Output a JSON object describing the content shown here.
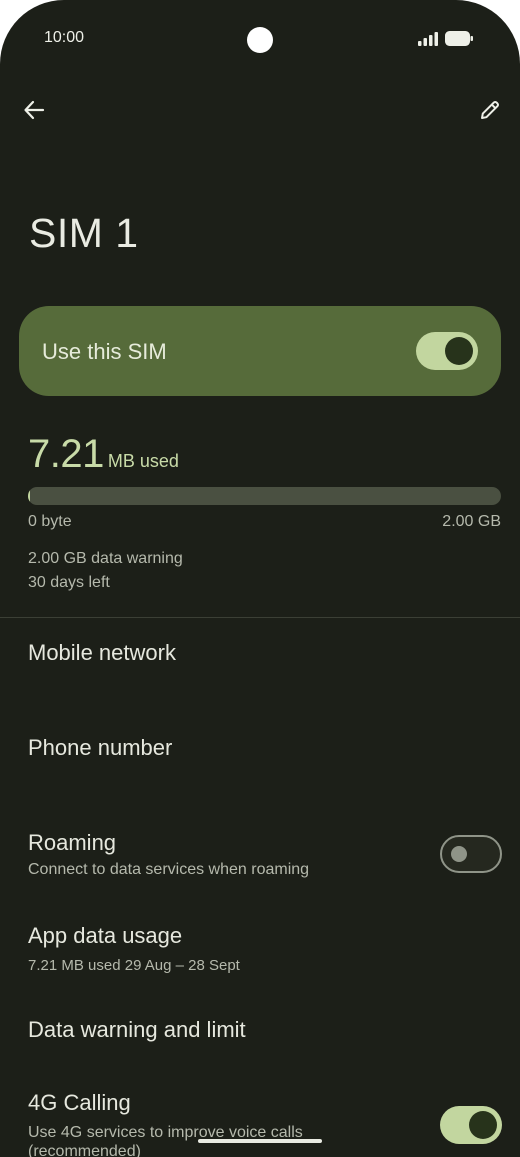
{
  "status_bar": {
    "time": "10:00"
  },
  "app_bar": {
    "back_icon": "arrow-back-icon",
    "edit_icon": "pencil-icon"
  },
  "title": "SIM 1",
  "use_sim": {
    "label": "Use this SIM",
    "enabled": true
  },
  "data_usage": {
    "value": "7.21",
    "unit": "MB used",
    "fraction_used": 0.0035,
    "min_label": "0 byte",
    "max_label": "2.00 GB",
    "warning": "2.00 GB data warning",
    "days_left": "30 days left"
  },
  "settings": {
    "mobile_network": {
      "title": "Mobile network"
    },
    "phone_number": {
      "title": "Phone number"
    },
    "roaming": {
      "title": "Roaming",
      "subtitle": "Connect to data services when roaming",
      "enabled": false
    },
    "app_data_usage": {
      "title": "App data usage",
      "subtitle": "7.21 MB used 29 Aug – 28 Sept"
    },
    "data_warning": {
      "title": "Data warning and limit"
    },
    "calling_4g": {
      "title": "4G Calling",
      "subtitle_line1": "Use 4G services to improve voice calls",
      "subtitle_line2": "(recommended)",
      "enabled": true
    }
  },
  "colors": {
    "background": "#1c1f18",
    "accent": "#c2d69f",
    "card": "#566b3a"
  }
}
